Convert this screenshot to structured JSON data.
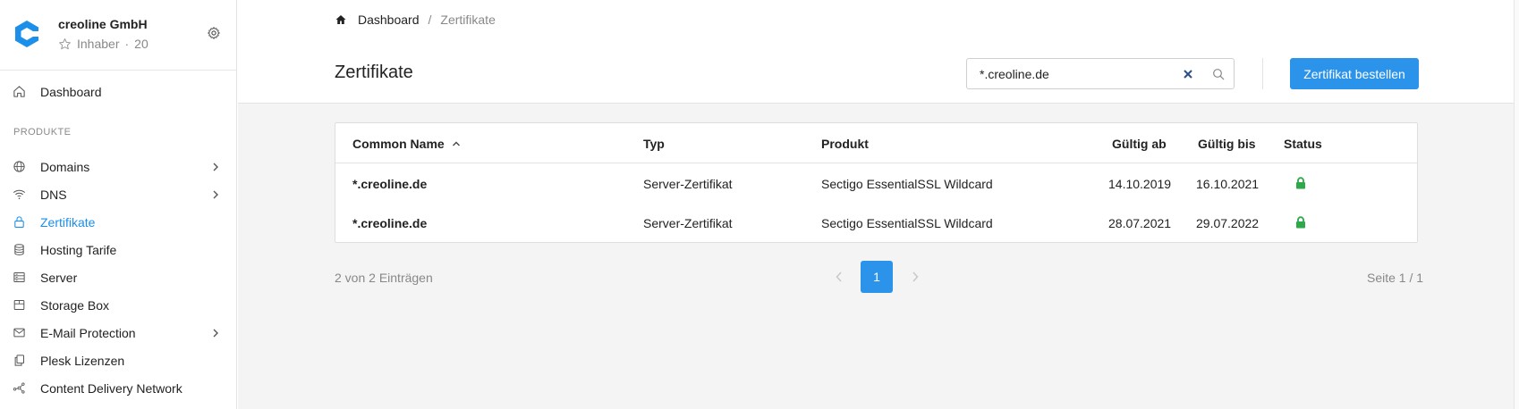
{
  "account": {
    "org_name": "creoline GmbH",
    "role": "Inhaber",
    "dot": "·",
    "count": "20"
  },
  "sidebar": {
    "dashboard": "Dashboard",
    "section_label": "PRODUKTE",
    "items": [
      {
        "label": "Domains",
        "icon": "globe-icon"
      },
      {
        "label": "DNS",
        "icon": "wifi-icon"
      },
      {
        "label": "Zertifikate",
        "icon": "lock-icon"
      },
      {
        "label": "Hosting Tarife",
        "icon": "database-icon"
      },
      {
        "label": "Server",
        "icon": "server-icon"
      },
      {
        "label": "Storage Box",
        "icon": "box-icon"
      },
      {
        "label": "E-Mail Protection",
        "icon": "mail-icon"
      },
      {
        "label": "Plesk Lizenzen",
        "icon": "copy-icon"
      },
      {
        "label": "Content Delivery Network",
        "icon": "network-icon"
      }
    ]
  },
  "breadcrumb": {
    "home": "Dashboard",
    "separator": "/",
    "current": "Zertifikate"
  },
  "header": {
    "title": "Zertifikate",
    "order_button": "Zertifikat bestellen"
  },
  "search": {
    "value": "*.creoline.de"
  },
  "table": {
    "columns": {
      "common_name": "Common Name",
      "type": "Typ",
      "product": "Produkt",
      "valid_from": "Gültig ab",
      "valid_to": "Gültig bis",
      "status": "Status"
    },
    "rows": [
      {
        "common_name": "*.creoline.de",
        "type": "Server-Zertifikat",
        "product": "Sectigo EssentialSSL Wildcard",
        "valid_from": "14.10.2019",
        "valid_to": "16.10.2021"
      },
      {
        "common_name": "*.creoline.de",
        "type": "Server-Zertifikat",
        "product": "Sectigo EssentialSSL Wildcard",
        "valid_from": "28.07.2021",
        "valid_to": "29.07.2022"
      }
    ]
  },
  "pagination": {
    "summary": "2 von 2 Einträgen",
    "current_page": "1",
    "page_info": "Seite 1 / 1"
  },
  "colors": {
    "accent": "#2b93ea",
    "status_ok": "#2ea84a",
    "logo": "#1b8fea"
  }
}
